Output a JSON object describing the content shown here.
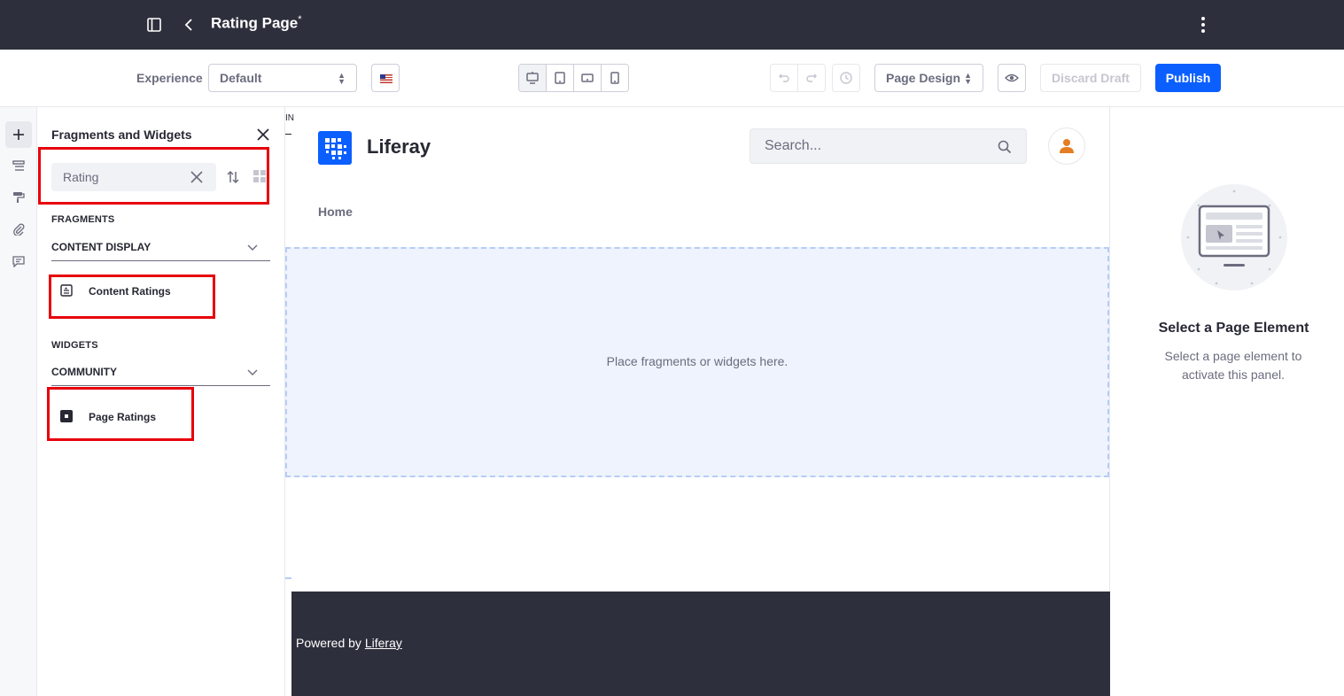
{
  "topbar": {
    "page_title": "Rating Page",
    "draft_marker": "*"
  },
  "toolbar": {
    "experience_label": "Experience",
    "experience_value": "Default",
    "page_design_value": "Page Design",
    "discard_label": "Discard Draft",
    "publish_label": "Publish"
  },
  "fragments_panel": {
    "title": "Fragments and Widgets",
    "search_value": "Rating",
    "fragments_label": "FRAGMENTS",
    "fragments_category": "CONTENT DISPLAY",
    "fragment_item": "Content Ratings",
    "widgets_label": "WIDGETS",
    "widgets_category": "COMMUNITY",
    "widget_item": "Page Ratings"
  },
  "canvas": {
    "cut_label": "IN",
    "site_name": "Liferay",
    "search_placeholder": "Search...",
    "nav_home": "Home",
    "dropzone_text": "Place fragments or widgets here.",
    "footer_prefix": "Powered by ",
    "footer_link": "Liferay"
  },
  "right_panel": {
    "title": "Select a Page Element",
    "description": "Select a page element to activate this panel."
  },
  "colors": {
    "topbar_bg": "#2e2f3c",
    "primary": "#0b5fff",
    "highlight_box": "#e8000b",
    "avatar_orange": "#e57d23"
  }
}
